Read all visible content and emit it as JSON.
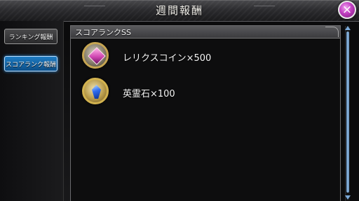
{
  "header": {
    "title": "週間報酬",
    "close_glyph": "×"
  },
  "sidebar": {
    "tabs": [
      {
        "label": "ランキング報酬",
        "selected": false
      },
      {
        "label": "スコアランク報酬",
        "selected": true
      }
    ]
  },
  "panel": {
    "section_title": "スコアランクSS",
    "rewards": [
      {
        "name": "レリクスコイン×500",
        "icon": "relic-coin-icon"
      },
      {
        "name": "英霊石×100",
        "icon": "spirit-stone-icon"
      }
    ]
  },
  "colors": {
    "close_button": "#c03ec0",
    "selected_tab": "#1e7bc2",
    "scrollbar": "#7aa9d8"
  }
}
